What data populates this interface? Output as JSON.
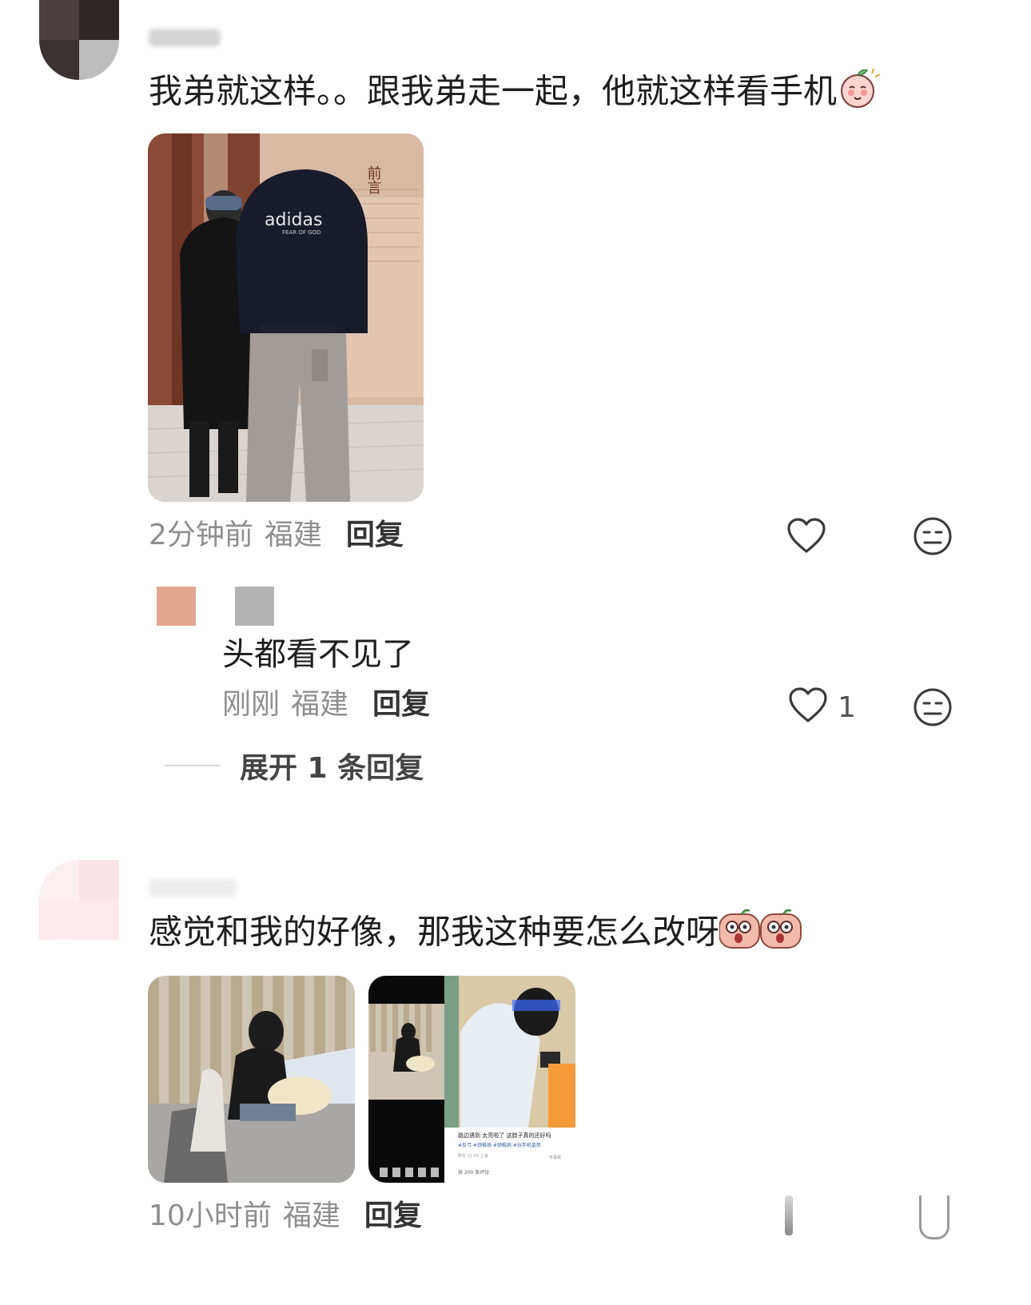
{
  "comments": [
    {
      "text": "我弟就这样。。跟我弟走一起，他就这样看手机",
      "time": "2分钟前",
      "location": "福建",
      "reply_label": "回复",
      "emoji": "shy-blush-emoji",
      "reply": {
        "text": "头都看不见了",
        "time": "刚刚",
        "location": "福建",
        "reply_label": "回复",
        "like_count": "1"
      },
      "expand_label": "展开 1 条回复"
    },
    {
      "text": "感觉和我的好像，那我这种要怎么改呀",
      "time": "10小时前",
      "location": "福建",
      "reply_label": "回复",
      "emoji": "shocked-emoji"
    }
  ],
  "photo_texts": {
    "hoodie_brand": "adidas",
    "hoodie_sub": "FEAR OF GOD",
    "wall_sign": "前言",
    "post_title": "路边遇到 太亮啦了 这脖子真的还好吗",
    "post_tags": "#反弓 #颈椎病 #颈椎病 #玩手机姿势",
    "post_meta": "昨天 11:59 上海",
    "post_collect": "不喜欢",
    "post_comments": "共 200 条评论"
  },
  "icons": {
    "like": "heart-outline-icon",
    "dislike": "neutral-face-icon"
  },
  "colors": {
    "text_primary": "#1e1e1e",
    "text_meta": "#8e8e8e",
    "icon_stroke": "#3a3a3a"
  }
}
